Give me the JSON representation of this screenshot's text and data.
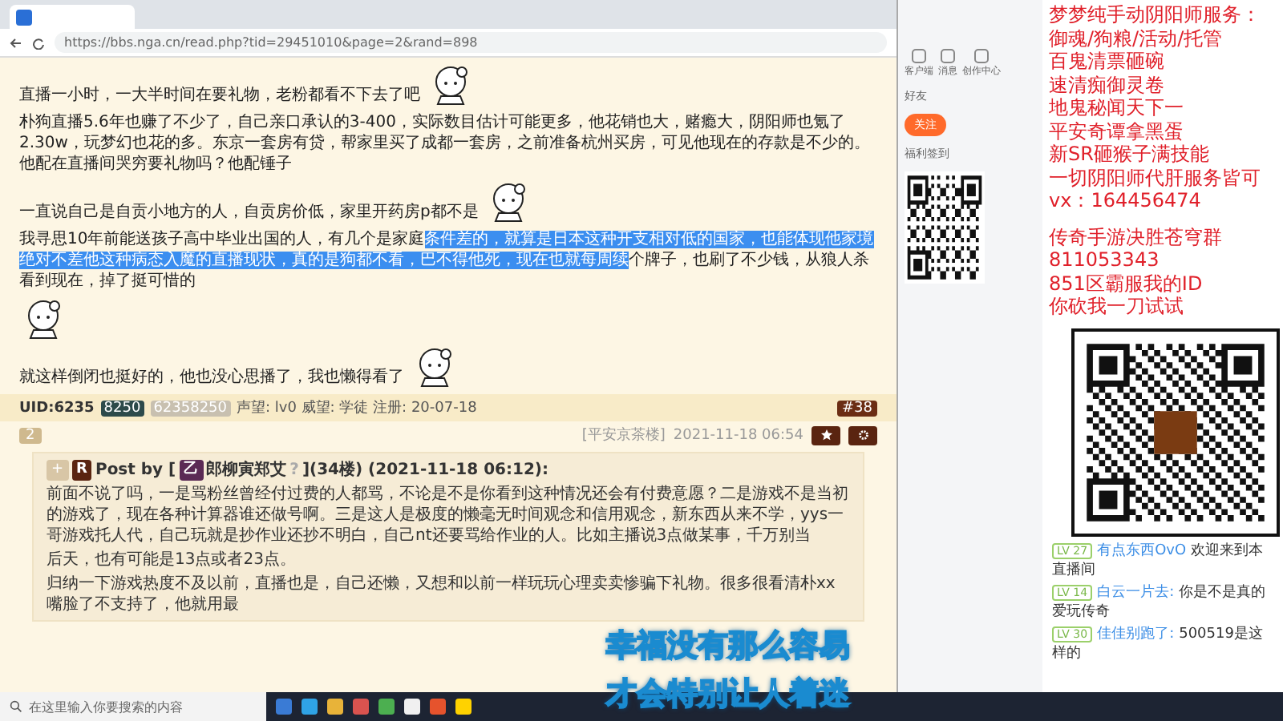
{
  "browser": {
    "url": "https://bbs.nga.cn/read.php?tid=29451010&page=2&rand=898"
  },
  "post": {
    "blocks": [
      {
        "kind": "paragraph",
        "sticker": true,
        "segments": [
          {
            "text": "直播一小时，一大半时间在要礼物，老粉都看不下去了吧",
            "selected": false
          }
        ]
      },
      {
        "kind": "paragraph",
        "sticker": false,
        "segments": [
          {
            "text": "朴狗直播5.6年也赚了不少了，自己亲口承认的3-400，实际数目估计可能更多，他花销也大，赌瘾大，阴阳师也氪了2.30w，玩梦幻也花的多。东京一套房有贷，帮家里买了成都一套房，之前准备杭州买房，可见他现在的存款是不少的。他配在直播间哭穷要礼物吗？他配锤子",
            "selected": false
          }
        ]
      },
      {
        "kind": "paragraph",
        "sticker": true,
        "segments": [
          {
            "text": "一直说自己是自贡小地方的人，自贡房价低，家里开药房p都不是",
            "selected": false
          }
        ]
      },
      {
        "kind": "paragraph",
        "sticker": false,
        "segments": [
          {
            "text": "我寻思10年前能送孩子高中毕业出国的人，有几个是家庭",
            "selected": false
          },
          {
            "text": "条件差的，就算是日本这种开支相对低的国家，也能体现他家境绝对不差他这种病态入魔的直播现状，真的是狗都不看，巴不得他死，现在也就每周续",
            "selected": true
          },
          {
            "text": "个牌子，也刷了不少钱，从狼人杀看到现在，掉了挺可惜的",
            "selected": false
          }
        ]
      },
      {
        "kind": "sticker"
      },
      {
        "kind": "paragraph",
        "sticker": true,
        "segments": [
          {
            "text": "就这样倒闭也挺好的，他也没心思播了，我也懒得看了",
            "selected": false
          }
        ]
      }
    ]
  },
  "user_bar": {
    "uid_prefix": "UID:6235",
    "uid_badge": "8250",
    "uid_full": "62358250",
    "meta": "声望: lv0 威望: 学徒 注册: 20-07-18",
    "floor": "#38"
  },
  "actions": {
    "likes": "2",
    "forum": "[平安京茶楼]",
    "time": "2021-11-18 06:54"
  },
  "quote": {
    "expand": "+",
    "avatar_letter": "R",
    "post_by": "Post by [",
    "level_badge": "乙",
    "author": "郎柳寅郑艾",
    "author_mark": "?",
    "tail": "](34楼) (2021-11-18 06:12):",
    "paragraphs": [
      "前面不说了吗，一是骂粉丝曾经付过费的人都骂，不论是不是你看到这种情况还会有付费意愿？二是游戏不是当初的游戏了，现在各种计算器谁还做号啊。三是这人是极度的懒毫无时间观念和信用观念，新东西从来不学，yys一哥游戏托人代，自己玩就是抄作业还抄不明白，自己nt还要骂给作业的人。比如主播说3点做某事，千万别当",
      "后天，也有可能是13点或者23点。",
      "归纳一下游戏热度不及以前，直播也是，自己还懒，又想和以前一样玩玩心理卖卖惨骗下礼物。很多很看清朴xx嘴脸了不支持了，他就用最"
    ]
  },
  "site": {
    "nav": [
      "客户端",
      "消息",
      "创作中心"
    ],
    "friends": "好友",
    "follow": "关注",
    "checkin": "福利签到"
  },
  "ad_lines": [
    "梦梦纯手动阴阳师服务：",
    "御魂/狗粮/活动/托管",
    "百鬼清票砸碗",
    "速清痴御灵卷",
    "地鬼秘闻天下一",
    "平安奇谭拿黑蛋",
    "新SR砸猴子满技能",
    "一切阴阳师代肝服务皆可",
    "vx：164456474",
    "传奇手游决胜苍穹群",
    "811053343",
    "851区霸服我的ID",
    "你砍我一刀试试"
  ],
  "chat": [
    {
      "level": "LV 27",
      "name": "有点东西OvO",
      "text": "欢迎来到本直播间"
    },
    {
      "level": "LV 14",
      "name": "白云一片去:",
      "text": "你是不是真的爱玩传奇"
    },
    {
      "level": "LV 30",
      "name": "佳佳别跑了:",
      "text": "500519是这样的"
    }
  ],
  "subtitles": [
    "幸福没有那么容易",
    "才会特别让人着迷"
  ],
  "taskbar": {
    "search_placeholder": "在这里输入你要搜索的内容"
  }
}
